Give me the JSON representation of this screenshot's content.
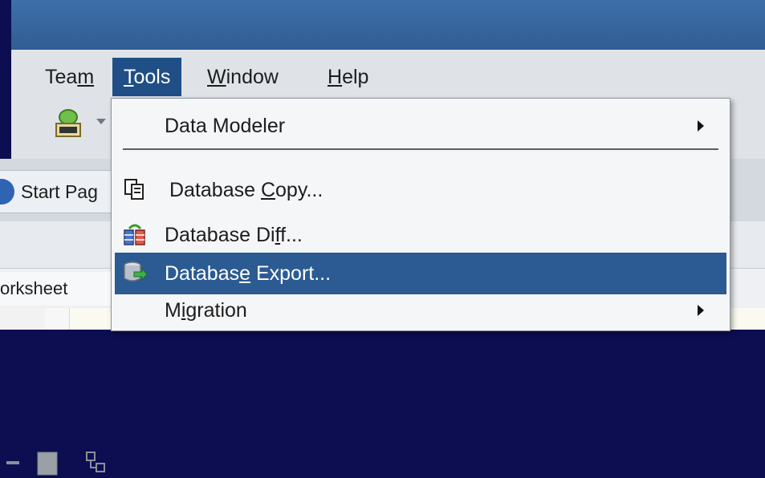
{
  "menubar": {
    "items": [
      {
        "label_pre": "Tea",
        "label_ul": "m",
        "label_post": ""
      },
      {
        "label_pre": "",
        "label_ul": "T",
        "label_post": "ools"
      },
      {
        "label_pre": "",
        "label_ul": "W",
        "label_post": "indow"
      },
      {
        "label_pre": "",
        "label_ul": "H",
        "label_post": "elp"
      }
    ],
    "active_index": 1
  },
  "tabs": {
    "start_page": "Start Pag"
  },
  "worksheet": {
    "tab_label": "orksheet"
  },
  "tools_menu": {
    "items": [
      {
        "pre": "Data Modeler",
        "ul": "",
        "post": "",
        "icon": "",
        "submenu": true
      },
      {
        "pre": "Database ",
        "ul": "C",
        "post": "opy...",
        "icon": "copy-icon",
        "submenu": false
      },
      {
        "pre": "Database Di",
        "ul": "f",
        "post": "f...",
        "icon": "diff-icon",
        "submenu": false
      },
      {
        "pre": "Databas",
        "ul": "e",
        "post": " Export...",
        "icon": "export-icon",
        "submenu": false,
        "highlighted": true
      },
      {
        "pre": "M",
        "ul": "i",
        "post": "gration",
        "icon": "",
        "submenu": true
      }
    ]
  },
  "colors": {
    "menu_highlight": "#2b5b92",
    "active_menu": "#1f4f86",
    "background": "#0d0d52"
  }
}
